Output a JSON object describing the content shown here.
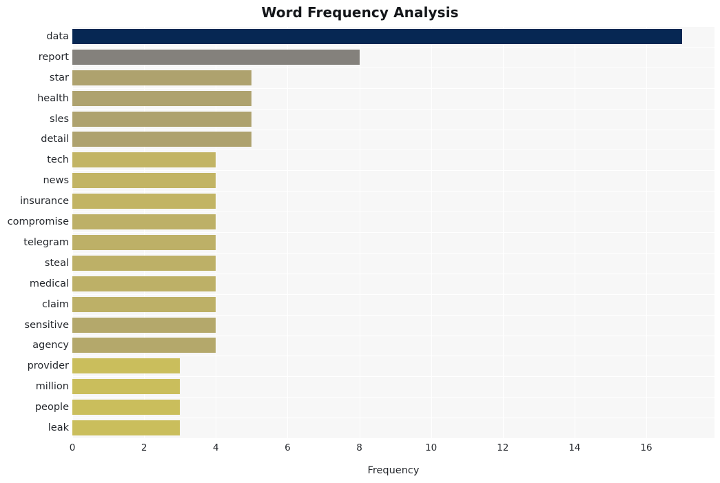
{
  "chart_data": {
    "type": "bar",
    "orientation": "horizontal",
    "title": "Word Frequency Analysis",
    "xlabel": "Frequency",
    "ylabel": "",
    "categories": [
      "data",
      "report",
      "star",
      "health",
      "sles",
      "detail",
      "tech",
      "news",
      "insurance",
      "compromise",
      "telegram",
      "steal",
      "medical",
      "claim",
      "sensitive",
      "agency",
      "provider",
      "million",
      "people",
      "leak"
    ],
    "values": [
      17,
      8,
      5,
      5,
      5,
      5,
      4,
      4,
      4,
      4,
      4,
      4,
      4,
      4,
      4,
      4,
      3,
      3,
      3,
      3
    ],
    "bar_colors": [
      "#062753",
      "#84817c",
      "#aea26e",
      "#aea26e",
      "#aea26e",
      "#aea26e",
      "#c2b464",
      "#c2b464",
      "#c2b464",
      "#bdb067",
      "#bdb067",
      "#bdb067",
      "#bdb067",
      "#bdb067",
      "#b4a86b",
      "#b4a86b",
      "#cabe5c",
      "#cabe5c",
      "#cabe5c",
      "#cabe5c"
    ],
    "xlim": [
      0,
      17.9
    ],
    "xticks": [
      0,
      2,
      4,
      6,
      8,
      10,
      12,
      14,
      16
    ],
    "xtick_labels": [
      "0",
      "2",
      "4",
      "6",
      "8",
      "10",
      "12",
      "14",
      "16"
    ],
    "grid": true,
    "grid_color": "#ffffff",
    "plot_background": "#f7f7f7",
    "figure_background": "#ffffff",
    "legend": null
  }
}
